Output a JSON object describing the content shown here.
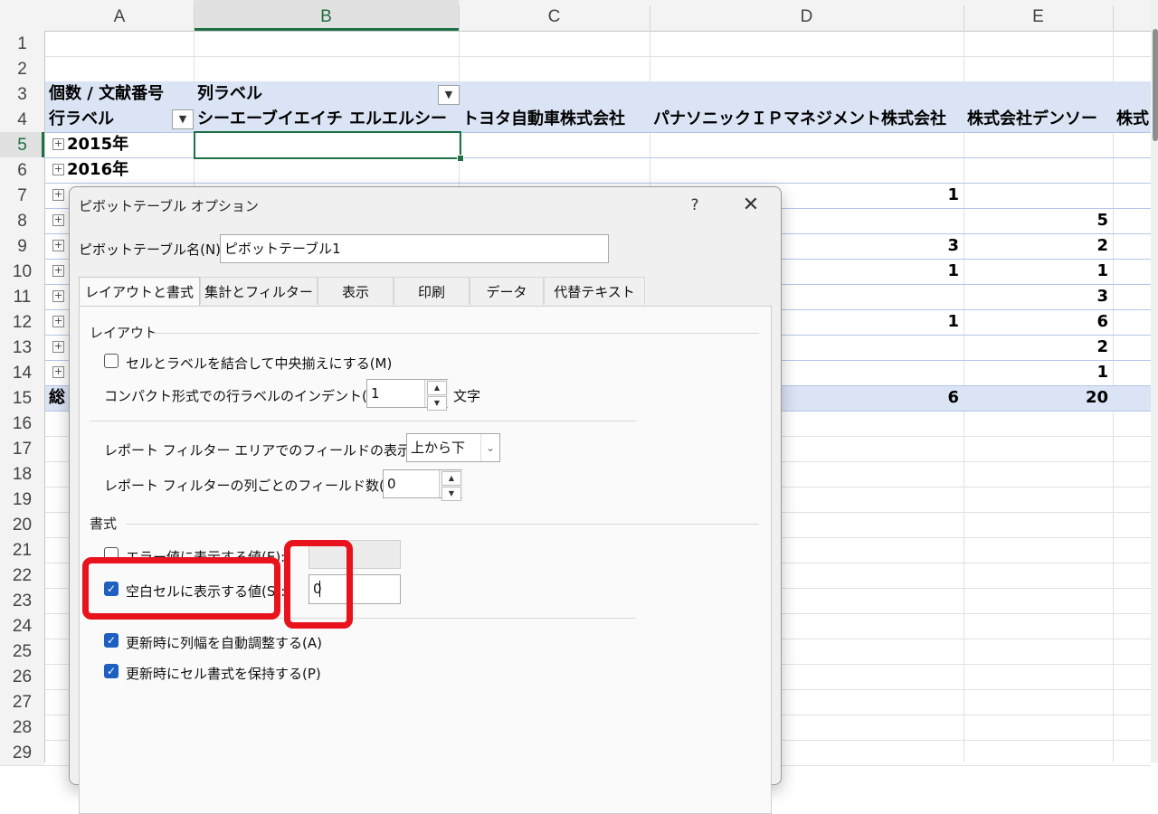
{
  "columns": [
    "A",
    "B",
    "C",
    "D",
    "E"
  ],
  "rows": [
    "1",
    "2",
    "3",
    "4",
    "5",
    "6",
    "7",
    "8",
    "9",
    "10",
    "11",
    "12",
    "13",
    "14",
    "15",
    "16",
    "17",
    "18",
    "19",
    "20",
    "21",
    "22",
    "23",
    "24",
    "25",
    "26",
    "27",
    "28",
    "29"
  ],
  "pivot": {
    "count_label": "個数 / 文献番号",
    "col_labels": "列ラベル",
    "row_labels": "行ラベル",
    "headers": [
      "シーエーブイエイチ",
      "エルエルシー",
      "トヨタ自動車株式会社",
      "パナソニックＩＰマネジメント株式会社",
      "株式会社デンソー",
      "株式"
    ],
    "rows": [
      {
        "label": "2015年"
      },
      {
        "label": "2016年"
      }
    ],
    "total_label": "総",
    "values_d": [
      "1",
      "",
      "3",
      "1",
      "",
      "1",
      "",
      "",
      "6"
    ],
    "values_e": [
      "",
      "5",
      "2",
      "1",
      "3",
      "6",
      "2",
      "1",
      "20"
    ]
  },
  "dialog": {
    "title": "ピボットテーブル オプション",
    "help": "?",
    "close": "✕",
    "name_label": "ピボットテーブル名(N):",
    "name_value": "ピボットテーブル1",
    "tabs": [
      "レイアウトと書式",
      "集計とフィルター",
      "表示",
      "印刷",
      "データ",
      "代替テキスト"
    ],
    "layout_group": "レイアウト",
    "merge_label": "セルとラベルを結合して中央揃えにする(M)",
    "merge_checked": false,
    "indent_label": "コンパクト形式での行ラベルのインデント(C):",
    "indent_value": "1",
    "indent_unit": "文字",
    "filter_area_label": "レポート フィルター エリアでのフィールドの表示(D):",
    "filter_area_value": "上から下",
    "filter_count_label": "レポート フィルターの列ごとのフィールド数(F):",
    "filter_count_value": "0",
    "format_group": "書式",
    "error_label": "エラー値に表示する値(E):",
    "error_checked": false,
    "empty_label": "空白セルに表示する値(S):",
    "empty_checked": true,
    "empty_value": "0",
    "autofit_label": "更新時に列幅を自動調整する(A)",
    "autofit_checked": true,
    "preserve_label": "更新時にセル書式を保持する(P)",
    "preserve_checked": true
  },
  "colors": {
    "highlight": "#e8131c",
    "pivot_band": "#dbe4f4",
    "selection": "#1e7145",
    "checkbox": "#1f5fbf"
  }
}
